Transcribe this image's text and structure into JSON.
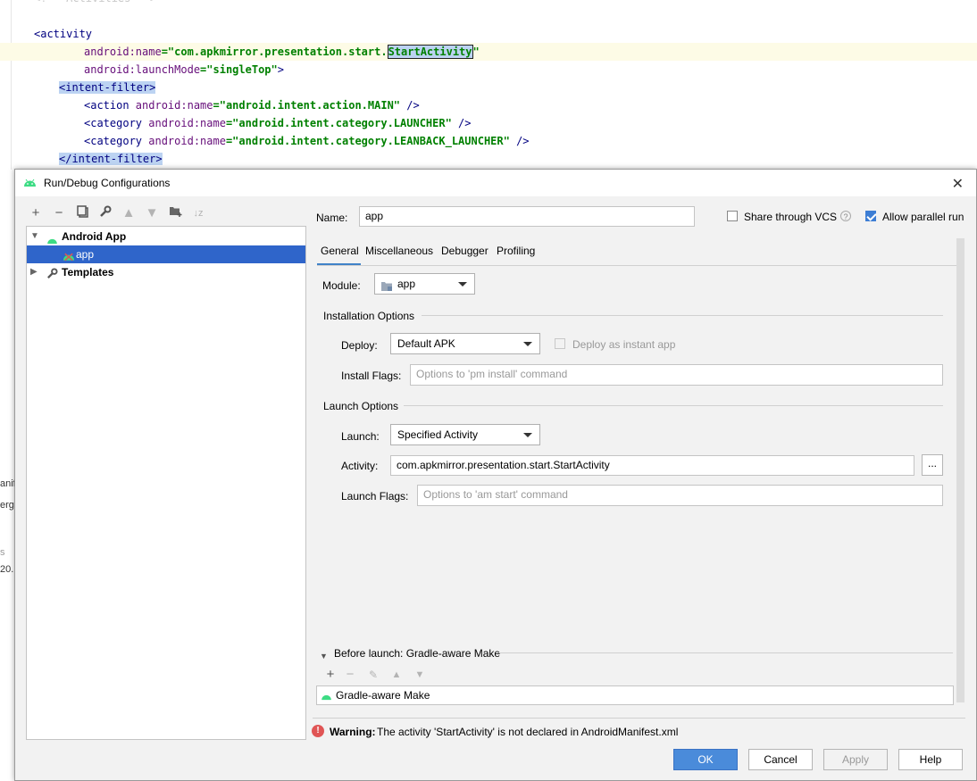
{
  "editor": {
    "top_comment": "<!-- Activities -->",
    "lines": {
      "activity_open": "<activity",
      "name_attr_ns": "android:",
      "name_attr": "name",
      "name_value_prefix": "=\"com.apkmirror.presentation.start.",
      "name_value_selected": "StartActivity",
      "name_value_suffix": "\"",
      "launch_attr_ns": "android:",
      "launch_attr": "launchMode",
      "launch_value": "=\"singleTop\"",
      "launch_close": ">",
      "intent_filter_open": "<intent-filter>",
      "action_line_tag": "<action ",
      "action_line_attr": "android:name",
      "action_line_val": "=\"android.intent.action.MAIN\"",
      "action_line_end": " />",
      "category1_tag": "<category ",
      "category1_attr": "android:name",
      "category1_val": "=\"android.intent.category.LAUNCHER\"",
      "category1_end": " />",
      "category2_tag": "<category ",
      "category2_attr": "android:name",
      "category2_val": "=\"android.intent.category.LEANBACK_LAUNCHER\"",
      "category2_end": " />",
      "intent_filter_close": "</intent-filter>"
    },
    "left_fragments": [
      "anif",
      "erge",
      "s",
      "20."
    ]
  },
  "dialog": {
    "title": "Run/Debug Configurations",
    "toolbar_icons": [
      "add-icon",
      "remove-icon",
      "copy-icon",
      "wrench-icon",
      "move-up-icon",
      "move-down-icon",
      "new-folder-icon",
      "sort-icon"
    ],
    "tree": {
      "android_app_label": "Android App",
      "app_label": "app",
      "templates_label": "Templates"
    },
    "name_label": "Name:",
    "name_value": "app",
    "share_vcs_label": "Share through VCS",
    "share_vcs_checked": false,
    "allow_parallel_label": "Allow parallel run",
    "allow_parallel_checked": true,
    "tabs": [
      "General",
      "Miscellaneous",
      "Debugger",
      "Profiling"
    ],
    "active_tab": "General",
    "module_label": "Module:",
    "module_value": "app",
    "installation_options_title": "Installation Options",
    "deploy_label": "Deploy:",
    "deploy_value": "Default APK",
    "deploy_instant_label": "Deploy as instant app",
    "install_flags_label": "Install Flags:",
    "install_flags_placeholder": "Options to 'pm install' command",
    "launch_options_title": "Launch Options",
    "launch_label": "Launch:",
    "launch_value": "Specified Activity",
    "activity_label": "Activity:",
    "activity_value": "com.apkmirror.presentation.start.StartActivity",
    "activity_browse": "...",
    "launch_flags_label": "Launch Flags:",
    "launch_flags_placeholder": "Options to 'am start' command",
    "before_launch_title": "Before launch: Gradle-aware Make",
    "before_launch_item": "Gradle-aware Make",
    "warning_bold": "Warning:",
    "warning_text": "The activity 'StartActivity' is not declared in AndroidManifest.xml",
    "buttons": {
      "ok": "OK",
      "cancel": "Cancel",
      "apply": "Apply",
      "help": "Help"
    },
    "colors": {
      "selection": "#2f65ca",
      "primary_button": "#4a8bda",
      "warning_icon": "#e05555",
      "android_green": "#3ddc84"
    }
  }
}
